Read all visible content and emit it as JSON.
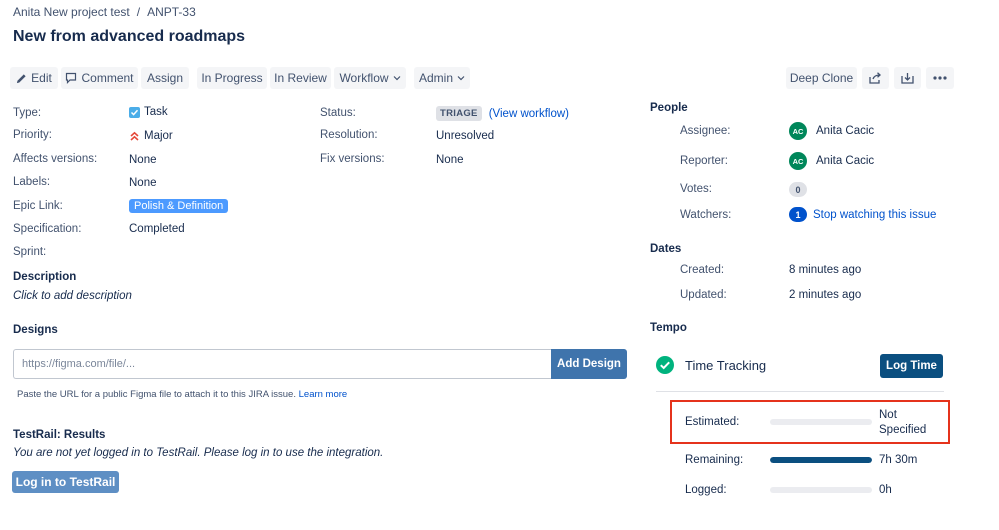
{
  "breadcrumb": {
    "project": "Anita New project test",
    "separator": "/",
    "issue_key": "ANPT-33"
  },
  "issue": {
    "title": "New from advanced roadmaps"
  },
  "toolbar": {
    "edit": "Edit",
    "comment": "Comment",
    "assign": "Assign",
    "in_progress": "In Progress",
    "in_review": "In Review",
    "workflow": "Workflow",
    "admin": "Admin",
    "deep_clone": "Deep Clone"
  },
  "details": {
    "type_label": "Type:",
    "type_value": "Task",
    "priority_label": "Priority:",
    "priority_value": "Major",
    "affects_label": "Affects versions:",
    "affects_value": "None",
    "labels_label": "Labels:",
    "labels_value": "None",
    "epic_label": "Epic Link:",
    "epic_value": "Polish & Definition",
    "spec_label": "Specification:",
    "spec_value": "Completed",
    "sprint_label": "Sprint:",
    "status_label": "Status:",
    "status_value": "TRIAGE",
    "view_workflow": "(View workflow)",
    "resolution_label": "Resolution:",
    "resolution_value": "Unresolved",
    "fix_label": "Fix versions:",
    "fix_value": "None"
  },
  "description": {
    "heading": "Description",
    "placeholder": "Click to add description"
  },
  "designs": {
    "heading": "Designs",
    "input_placeholder": "https://figma.com/file/...",
    "button": "Add Design",
    "hint": "Paste the URL for a public Figma file to attach it to this JIRA issue.",
    "learn_more": "Learn more"
  },
  "testrail": {
    "heading": "TestRail: Results",
    "message": "You are not yet logged in to TestRail. Please log in to use the integration.",
    "button": "Log in to TestRail"
  },
  "people": {
    "heading": "People",
    "assignee_label": "Assignee:",
    "assignee_initials": "AC",
    "assignee_name": "Anita Cacic",
    "reporter_label": "Reporter:",
    "reporter_initials": "AC",
    "reporter_name": "Anita Cacic",
    "votes_label": "Votes:",
    "votes_count": "0",
    "watchers_label": "Watchers:",
    "watchers_count": "1",
    "watch_link": "Stop watching this issue"
  },
  "dates": {
    "heading": "Dates",
    "created_label": "Created:",
    "created_value": "8 minutes ago",
    "updated_label": "Updated:",
    "updated_value": "2 minutes ago"
  },
  "tempo": {
    "heading": "Tempo",
    "time_tracking": "Time Tracking",
    "log_time": "Log Time",
    "estimated_label": "Estimated:",
    "estimated_value_1": "Not",
    "estimated_value_2": "Specified",
    "estimated_fraction": 0,
    "remaining_label": "Remaining:",
    "remaining_value": "7h 30m",
    "remaining_fraction": 1,
    "logged_label": "Logged:",
    "logged_value": "0h",
    "logged_fraction": 0
  },
  "colors": {
    "accent": "#0052cc",
    "tempo_bar": "#0b4f80",
    "success": "#00b37e",
    "highlight": "#e5331c",
    "avatar": "#00875a"
  }
}
